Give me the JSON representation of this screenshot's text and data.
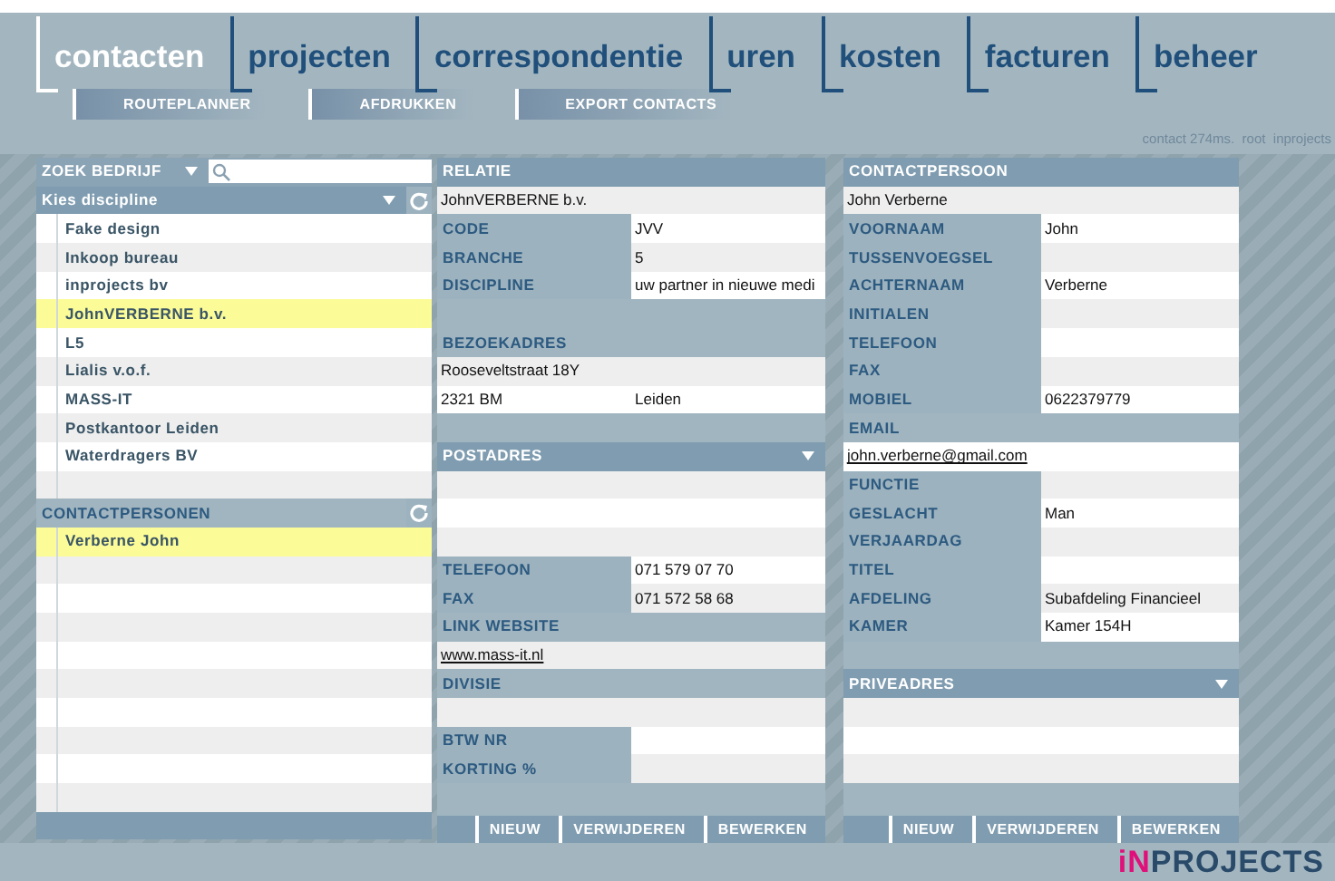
{
  "tabs": [
    {
      "label": "contacten",
      "selected": true
    },
    {
      "label": "projecten",
      "selected": false
    },
    {
      "label": "correspondentie",
      "selected": false
    },
    {
      "label": "uren",
      "selected": false
    },
    {
      "label": "kosten",
      "selected": false
    },
    {
      "label": "facturen",
      "selected": false
    },
    {
      "label": "beheer",
      "selected": false
    }
  ],
  "subtabs": [
    "ROUTEPLANNER",
    "AFDRUKKEN",
    "EXPORT CONTACTS"
  ],
  "status_text": "contact 274ms.  root  inprojects",
  "companies_panel": {
    "search_label": "ZOEK BEDRIJF",
    "discipline": "Kies discipline",
    "companies": [
      {
        "name": "Fake design",
        "selected": false
      },
      {
        "name": "Inkoop bureau",
        "selected": false
      },
      {
        "name": "inprojects bv",
        "selected": false
      },
      {
        "name": "JohnVERBERNE b.v.",
        "selected": true
      },
      {
        "name": "L5",
        "selected": false
      },
      {
        "name": "Lialis v.o.f.",
        "selected": false
      },
      {
        "name": "MASS-IT",
        "selected": false
      },
      {
        "name": "Postkantoor Leiden",
        "selected": false
      },
      {
        "name": "Waterdragers BV",
        "selected": false
      }
    ],
    "contacts_header": "CONTACTPERSONEN",
    "contacts": [
      {
        "name": "Verberne John",
        "selected": true
      }
    ]
  },
  "relatie_panel": {
    "rows": [
      {
        "kind": "header",
        "label": "RELATIE"
      },
      {
        "kind": "full",
        "value": "JohnVERBERNE b.v."
      },
      {
        "kind": "field",
        "label": "CODE",
        "value": "JVV"
      },
      {
        "kind": "field",
        "label": "BRANCHE",
        "value": "5"
      },
      {
        "kind": "field",
        "label": "DISCIPLINE",
        "value": "uw partner in nieuwe medi"
      },
      {
        "kind": "gap"
      },
      {
        "kind": "section",
        "label": "BEZOEKADRES"
      },
      {
        "kind": "full",
        "value": "Rooseveltstraat 18Y"
      },
      {
        "kind": "pair",
        "values": [
          "2321 BM",
          "Leiden"
        ]
      },
      {
        "kind": "gap"
      },
      {
        "kind": "dropdown",
        "label": "POSTADRES"
      },
      {
        "kind": "empty"
      },
      {
        "kind": "empty"
      },
      {
        "kind": "empty"
      },
      {
        "kind": "field",
        "label": "TELEFOON",
        "value": "071 579 07 70"
      },
      {
        "kind": "field",
        "label": "FAX",
        "value": "071 572 58 68"
      },
      {
        "kind": "section",
        "label": "LINK WEBSITE"
      },
      {
        "kind": "link",
        "value": "www.mass-it.nl"
      },
      {
        "kind": "section",
        "label": "DIVISIE"
      },
      {
        "kind": "empty"
      },
      {
        "kind": "field",
        "label": "BTW NR"
      },
      {
        "kind": "field",
        "label": "KORTING %"
      },
      {
        "kind": "gap"
      }
    ],
    "buttons": [
      "NIEUW",
      "VERWIJDEREN",
      "BEWERKEN"
    ]
  },
  "contactpersoon_panel": {
    "rows": [
      {
        "kind": "header",
        "label": "CONTACTPERSOON"
      },
      {
        "kind": "full",
        "value": "John Verberne"
      },
      {
        "kind": "field",
        "label": "VOORNAAM",
        "value": "John"
      },
      {
        "kind": "field",
        "label": "TUSSENVOEGSEL"
      },
      {
        "kind": "field",
        "label": "ACHTERNAAM",
        "value": "Verberne"
      },
      {
        "kind": "field",
        "label": "INITIALEN"
      },
      {
        "kind": "field",
        "label": "TELEFOON"
      },
      {
        "kind": "field",
        "label": "FAX"
      },
      {
        "kind": "field",
        "label": "MOBIEL",
        "value": "0622379779"
      },
      {
        "kind": "section",
        "label": "EMAIL"
      },
      {
        "kind": "link",
        "value": "john.verberne@gmail.com"
      },
      {
        "kind": "field",
        "label": "FUNCTIE"
      },
      {
        "kind": "field",
        "label": "GESLACHT",
        "value": "Man"
      },
      {
        "kind": "field",
        "label": "VERJAARDAG"
      },
      {
        "kind": "field",
        "label": "TITEL"
      },
      {
        "kind": "field",
        "label": "AFDELING",
        "value": "Subafdeling Financieel"
      },
      {
        "kind": "field",
        "label": "KAMER",
        "value": "Kamer 154H"
      },
      {
        "kind": "gap"
      },
      {
        "kind": "dropdown",
        "label": "PRIVEADRES"
      },
      {
        "kind": "empty"
      },
      {
        "kind": "empty"
      },
      {
        "kind": "empty"
      },
      {
        "kind": "gap"
      }
    ],
    "buttons": [
      "NIEUW",
      "VERWIJDEREN",
      "BEWERKEN"
    ]
  },
  "logo": {
    "accent": "iN",
    "rest": "PROJECTS"
  }
}
